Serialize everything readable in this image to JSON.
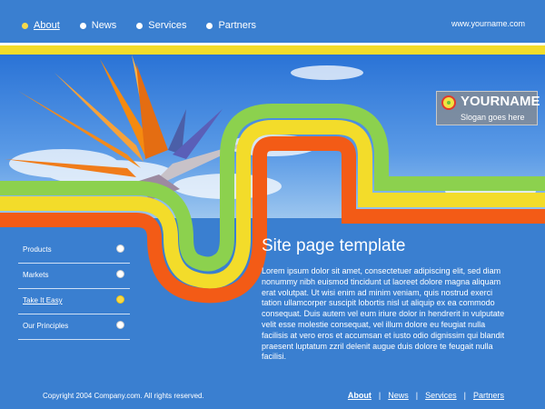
{
  "topnav": {
    "items": [
      {
        "label": "About",
        "active": true
      },
      {
        "label": "News",
        "active": false
      },
      {
        "label": "Services",
        "active": false
      },
      {
        "label": "Partners",
        "active": false
      }
    ],
    "site_url": "www.yourname.com"
  },
  "logo": {
    "name": "YOURNAME",
    "slogan": "Slogan goes here"
  },
  "sidebar": {
    "items": [
      {
        "label": "Products",
        "active": false
      },
      {
        "label": "Markets",
        "active": false
      },
      {
        "label": "Take It Easy",
        "active": true
      },
      {
        "label": "Our Principles",
        "active": false
      }
    ]
  },
  "content": {
    "title": "Site page template",
    "body": "Lorem ipsum dolor sit amet, consectetuer adipiscing elit, sed diam nonummy nibh euismod tincidunt ut laoreet dolore magna aliquam erat volutpat. Ut wisi enim ad minim veniam, quis nostrud exerci tation ullamcorper suscipit lobortis nisl ut aliquip ex ea commodo consequat. Duis autem vel eum iriure dolor in hendrerit in vulputate velit esse molestie consequat, vel illum dolore eu feugiat nulla facilisis at vero eros et accumsan et iusto odio dignissim qui blandit praesent luptatum zzril delenit augue duis dolore te feugait nulla facilisi."
  },
  "footer": {
    "copyright": "Copyright 2004 Company.com. All rights reserved.",
    "links": [
      {
        "label": "About",
        "active": true
      },
      {
        "label": "News",
        "active": false
      },
      {
        "label": "Services",
        "active": false
      },
      {
        "label": "Partners",
        "active": false
      }
    ]
  },
  "colors": {
    "background": "#3a7fd0",
    "stripe_yellow": "#f3dc2a",
    "band_green": "#8cd14e",
    "band_yellow": "#f3dc2a",
    "band_orange": "#f35b16",
    "accent_dot": "#f7d94a"
  },
  "icons": {
    "nav_bullet": "circle-bullet-icon",
    "logo_mark": "ring-logo-icon",
    "menu_bullet": "circle-bullet-icon"
  }
}
